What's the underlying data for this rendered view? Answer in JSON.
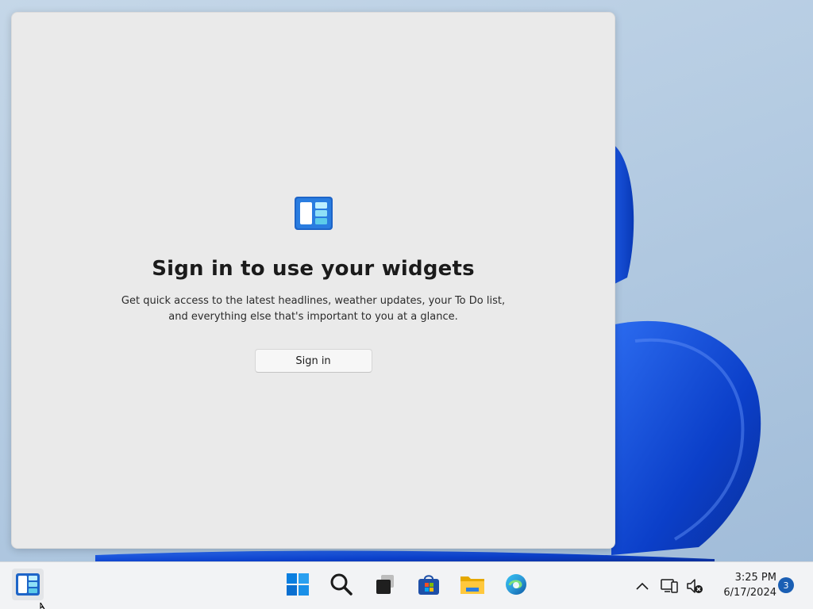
{
  "widgets_panel": {
    "title": "Sign in to use your widgets",
    "description": "Get quick access to the latest headlines, weather updates, your To Do list, and everything else that's important to you at a glance.",
    "sign_in_label": "Sign in",
    "app_icon": "widgets-icon"
  },
  "taskbar": {
    "widgets_icon": "widgets-icon",
    "apps": [
      {
        "name": "Start",
        "icon": "windows-logo-icon"
      },
      {
        "name": "Search",
        "icon": "search-icon"
      },
      {
        "name": "Task View",
        "icon": "task-view-icon"
      },
      {
        "name": "Microsoft Store",
        "icon": "store-icon"
      },
      {
        "name": "File Explorer",
        "icon": "file-explorer-icon"
      },
      {
        "name": "Microsoft Edge",
        "icon": "edge-icon"
      }
    ],
    "tray": {
      "overflow_icon": "chevron-up-icon",
      "network_icon": "network-icon",
      "volume_icon": "volume-muted-icon",
      "time": "3:25 PM",
      "date": "6/17/2024",
      "notification_count": "3"
    }
  },
  "colors": {
    "accent": "#1a5fb4",
    "panel_background": "#eaeaea",
    "taskbar_background": "#f2f3f5"
  }
}
